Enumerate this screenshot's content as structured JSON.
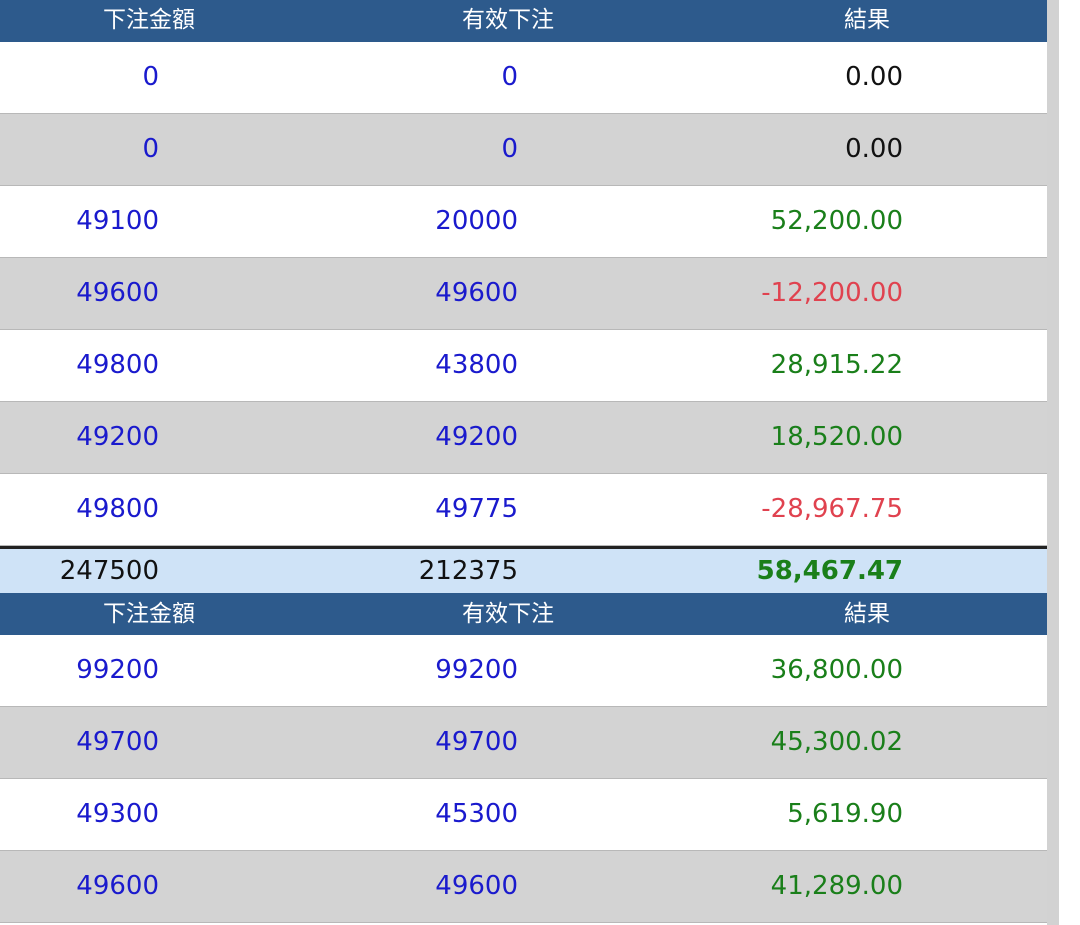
{
  "headers": {
    "bet_amount": "下注金額",
    "valid_bet": "有效下注",
    "result": "結果"
  },
  "section1": {
    "rows": [
      {
        "bet": "0",
        "valid": "0",
        "result": "0.00",
        "tone": "neutral"
      },
      {
        "bet": "0",
        "valid": "0",
        "result": "0.00",
        "tone": "neutral"
      },
      {
        "bet": "49100",
        "valid": "20000",
        "result": "52,200.00",
        "tone": "positive"
      },
      {
        "bet": "49600",
        "valid": "49600",
        "result": "-12,200.00",
        "tone": "negative"
      },
      {
        "bet": "49800",
        "valid": "43800",
        "result": "28,915.22",
        "tone": "positive"
      },
      {
        "bet": "49200",
        "valid": "49200",
        "result": "18,520.00",
        "tone": "positive"
      },
      {
        "bet": "49800",
        "valid": "49775",
        "result": "-28,967.75",
        "tone": "negative"
      }
    ],
    "total": {
      "bet": "247500",
      "valid": "212375",
      "result": "58,467.47"
    }
  },
  "section2": {
    "rows": [
      {
        "bet": "99200",
        "valid": "99200",
        "result": "36,800.00",
        "tone": "positive"
      },
      {
        "bet": "49700",
        "valid": "49700",
        "result": "45,300.02",
        "tone": "positive"
      },
      {
        "bet": "49300",
        "valid": "45300",
        "result": "5,619.90",
        "tone": "positive"
      },
      {
        "bet": "49600",
        "valid": "49600",
        "result": "41,289.00",
        "tone": "positive"
      }
    ]
  },
  "colors": {
    "header_bg": "#2d5a8c",
    "bet_text": "#1a1acd",
    "positive": "#1a7f1a",
    "negative": "#e0424f",
    "total_bg": "#cfe3f7",
    "alt_row_bg": "#d3d3d3"
  }
}
